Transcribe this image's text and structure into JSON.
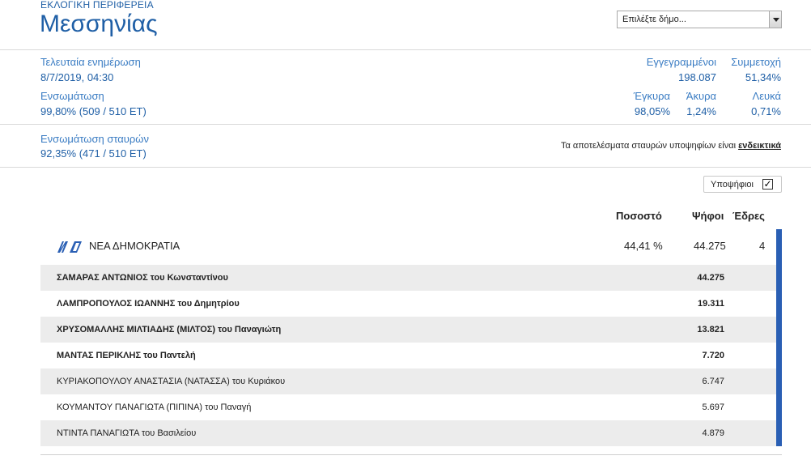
{
  "region": {
    "label": "ΕΚΛΟΓΙΚΗ ΠΕΡΙΦΕΡΕΙΑ",
    "name": "Μεσσηνίας"
  },
  "municipality_select": {
    "selected": "Επιλέξτε δήμο..."
  },
  "stats": {
    "last_update_label": "Τελευταία ενημέρωση",
    "last_update_value": "8/7/2019, 04:30",
    "integration_label": "Ενσωμάτωση",
    "integration_value": "99,80% (509 / 510 ΕΤ)",
    "registered_label": "Εγγεγραμμένοι",
    "registered_value": "198.087",
    "turnout_label": "Συμμετοχή",
    "turnout_value": "51,34%",
    "valid_label": "Έγκυρα",
    "valid_value": "98,05%",
    "invalid_label": "Άκυρα",
    "invalid_value": "1,24%",
    "blank_label": "Λευκά",
    "blank_value": "0,71%",
    "cross_label": "Ενσωμάτωση σταυρών",
    "cross_value": "92,35% (471 / 510 ΕΤ)"
  },
  "note": {
    "text": "Τα αποτελέσματα σταυρών υποψηφίων είναι ",
    "link": "ενδεικτικά"
  },
  "candidates_toggle": {
    "label": "Υποψήφιοι",
    "checked_mark": "✓"
  },
  "table": {
    "headers": {
      "percent": "Ποσοστό",
      "votes": "Ψήφοι",
      "seats": "Έδρες"
    },
    "party": {
      "name": "ΝΕΑ ΔΗΜΟΚΡΑΤΙΑ",
      "percent": "44,41 %",
      "votes": "44.275",
      "seats": "4",
      "logo_text": "ΝΔ",
      "color": "#2a5fb4"
    },
    "candidates": [
      {
        "name": "ΣΑΜΑΡΑΣ ΑΝΤΩΝΙΟΣ του Κωνσταντίνου",
        "votes": "44.275"
      },
      {
        "name": "ΛΑΜΠΡΟΠΟΥΛΟΣ ΙΩΑΝΝΗΣ του Δημητρίου",
        "votes": "19.311"
      },
      {
        "name": "ΧΡΥΣΟΜΑΛΛΗΣ ΜΙΛΤΙΑΔΗΣ (ΜΙΛΤΟΣ) του Παναγιώτη",
        "votes": "13.821"
      },
      {
        "name": "ΜΑΝΤΑΣ ΠΕΡΙΚΛΗΣ του Παντελή",
        "votes": "7.720"
      },
      {
        "name": "ΚΥΡΙΑΚΟΠΟΥΛΟΥ ΑΝΑΣΤΑΣΙΑ (ΝΑΤΑΣΣΑ) του Κυριάκου",
        "votes": "6.747"
      },
      {
        "name": "ΚΟΥΜΑΝΤΟΥ ΠΑΝΑΓΙΩΤΑ (ΠΙΠΙΝΑ) του Παναγή",
        "votes": "5.697"
      },
      {
        "name": "ΝΤΙΝΤΑ ΠΑΝΑΓΙΩΤΑ του Βασιλείου",
        "votes": "4.879"
      }
    ]
  }
}
